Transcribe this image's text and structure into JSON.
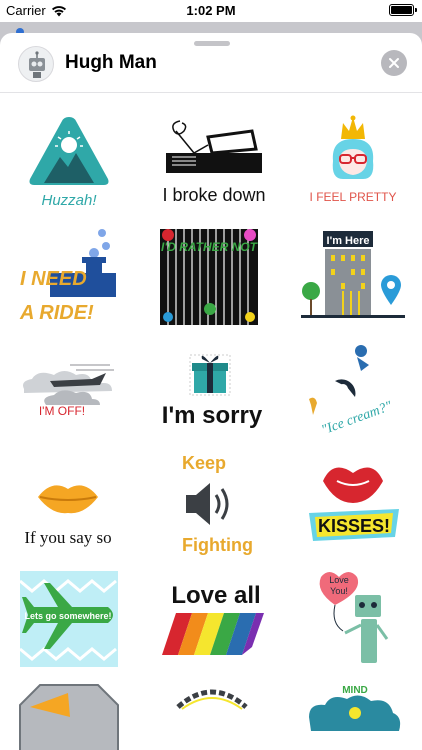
{
  "status_bar": {
    "carrier": "Carrier",
    "time": "1:02 PM"
  },
  "header": {
    "title": "Hugh Man",
    "close_icon": "close-icon"
  },
  "colors": {
    "teal": "#2fa8a8",
    "blue": "#1f6fb5",
    "gold": "#e8a92e",
    "red": "#d7262f",
    "green": "#3aa845",
    "cyan": "#67d3e6",
    "grey_text": "#8e8e93"
  },
  "stickers": [
    {
      "id": "huzzah",
      "text": "Huzzah!"
    },
    {
      "id": "i-broke-down",
      "text": "I broke down"
    },
    {
      "id": "i-feel-pretty",
      "text": "I FEEL PRETTY"
    },
    {
      "id": "i-need-a-ride",
      "text_top": "I NEED",
      "text_bottom": "A RIDE!"
    },
    {
      "id": "id-rather-not",
      "text": "I'D RATHER NOT"
    },
    {
      "id": "im-here",
      "text": "I'm Here"
    },
    {
      "id": "im-off",
      "text": "I'M OFF!"
    },
    {
      "id": "im-sorry",
      "text": "I'm sorry"
    },
    {
      "id": "ice-cream",
      "text": "\"Ice cream?\""
    },
    {
      "id": "if-you-say-so",
      "text": "If you say so"
    },
    {
      "id": "keep-fighting",
      "text_top": "Keep",
      "text_bottom": "Fighting"
    },
    {
      "id": "kisses",
      "text": "KISSES!"
    },
    {
      "id": "lets-go-somewhere",
      "text": "Lets go somewhere!"
    },
    {
      "id": "love-all",
      "text": "Love all"
    },
    {
      "id": "love-you",
      "text_top": "Love",
      "text_bottom": "You!"
    },
    {
      "id": "partial-left"
    },
    {
      "id": "partial-middle"
    },
    {
      "id": "mind",
      "text": "MIND"
    }
  ]
}
